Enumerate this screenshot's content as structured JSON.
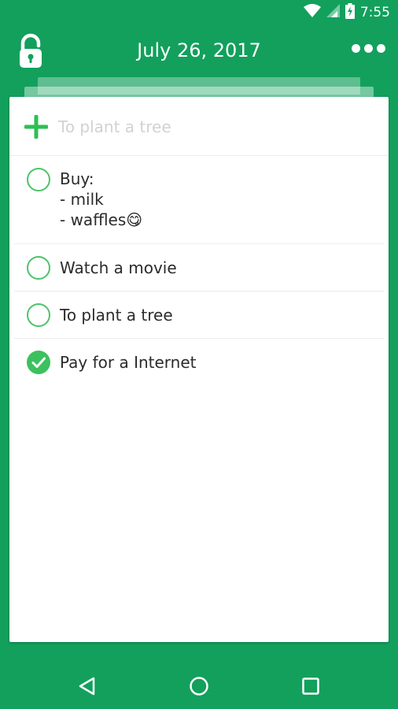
{
  "status_bar": {
    "time": "7:55",
    "icons": [
      "wifi-icon",
      "cellular-signal-icon",
      "battery-charging-icon"
    ]
  },
  "header": {
    "title": "July 26, 2017",
    "left_icon": "unlocked-padlock-icon",
    "right_icon": "more-options-icon"
  },
  "add_task": {
    "icon": "plus-icon",
    "placeholder": "To plant a tree"
  },
  "tasks": [
    {
      "text": "Buy:\n- milk\n- waffles😋",
      "completed": false
    },
    {
      "text": "Watch a movie",
      "completed": false
    },
    {
      "text": "To plant a tree",
      "completed": false
    },
    {
      "text": "Pay for a Internet",
      "completed": true
    }
  ],
  "nav_bar": {
    "buttons": [
      "back-icon",
      "home-icon",
      "recents-icon"
    ]
  },
  "colors": {
    "background": "#12a05c",
    "accent": "#3dc05e",
    "card": "#ffffff",
    "placeholder": "#cfd3d1"
  }
}
